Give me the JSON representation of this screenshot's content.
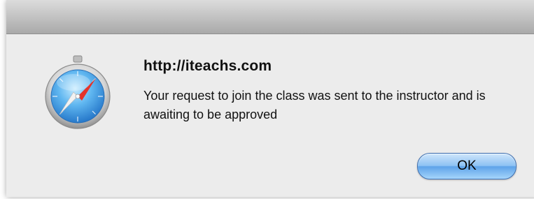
{
  "dialog": {
    "title": "http://iteachs.com",
    "message": "Your request to join the class was sent to the instructor and is awaiting to be approved",
    "ok_label": "OK",
    "icon": "safari-compass-icon"
  },
  "colors": {
    "background": "#ececec",
    "titlebar_top": "#dcdcdc",
    "titlebar_bottom": "#a9a9a9",
    "button_blue": "#6aaeef",
    "compass_needle_red": "#e5332a"
  }
}
